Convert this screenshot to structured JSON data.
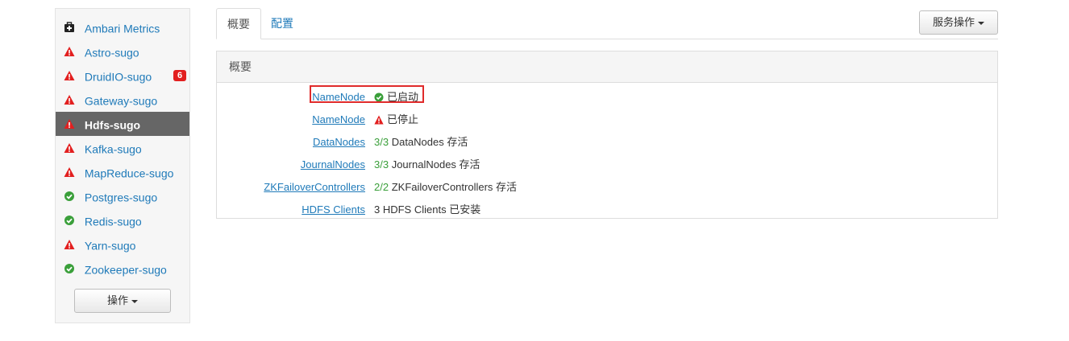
{
  "sidebar": {
    "services": [
      {
        "label": "Ambari Metrics",
        "icon": "medkit-icon",
        "status": "maintenance"
      },
      {
        "label": "Astro-sugo",
        "icon": "warning-icon",
        "status": "alert"
      },
      {
        "label": "DruidIO-sugo",
        "icon": "warning-icon",
        "status": "alert",
        "badge": "6"
      },
      {
        "label": "Gateway-sugo",
        "icon": "warning-icon",
        "status": "alert"
      },
      {
        "label": "Hdfs-sugo",
        "icon": "warning-icon",
        "status": "alert",
        "active": true
      },
      {
        "label": "Kafka-sugo",
        "icon": "warning-icon",
        "status": "alert"
      },
      {
        "label": "MapReduce-sugo",
        "icon": "warning-icon",
        "status": "alert"
      },
      {
        "label": "Postgres-sugo",
        "icon": "check-circle-icon",
        "status": "ok"
      },
      {
        "label": "Redis-sugo",
        "icon": "check-circle-icon",
        "status": "ok"
      },
      {
        "label": "Yarn-sugo",
        "icon": "warning-icon",
        "status": "alert"
      },
      {
        "label": "Zookeeper-sugo",
        "icon": "check-circle-icon",
        "status": "ok"
      }
    ],
    "actions_label": "操作"
  },
  "tabs": [
    {
      "label": "概要",
      "active": true
    },
    {
      "label": "配置",
      "active": false
    }
  ],
  "service_actions_label": "服务操作",
  "panel": {
    "title": "概要",
    "rows": [
      {
        "name": "NameNode",
        "icon": "check-circle-icon",
        "value": "已启动",
        "highlighted": true
      },
      {
        "name": "NameNode",
        "icon": "warning-icon",
        "value": "已停止"
      },
      {
        "name": "DataNodes",
        "count": "3/3",
        "value": "DataNodes 存活"
      },
      {
        "name": "JournalNodes",
        "count": "3/3",
        "value": "JournalNodes 存活"
      },
      {
        "name": "ZKFailoverControllers",
        "count": "2/2",
        "value": "ZKFailoverControllers 存活"
      },
      {
        "name": "HDFS Clients",
        "count": "",
        "value": "3 HDFS Clients 已安装"
      }
    ]
  },
  "colors": {
    "link": "#1f7ab9",
    "alert": "#e21f1f",
    "ok": "#3a9f3a",
    "active_bg": "#666666",
    "highlight_border": "#e02b2b"
  }
}
